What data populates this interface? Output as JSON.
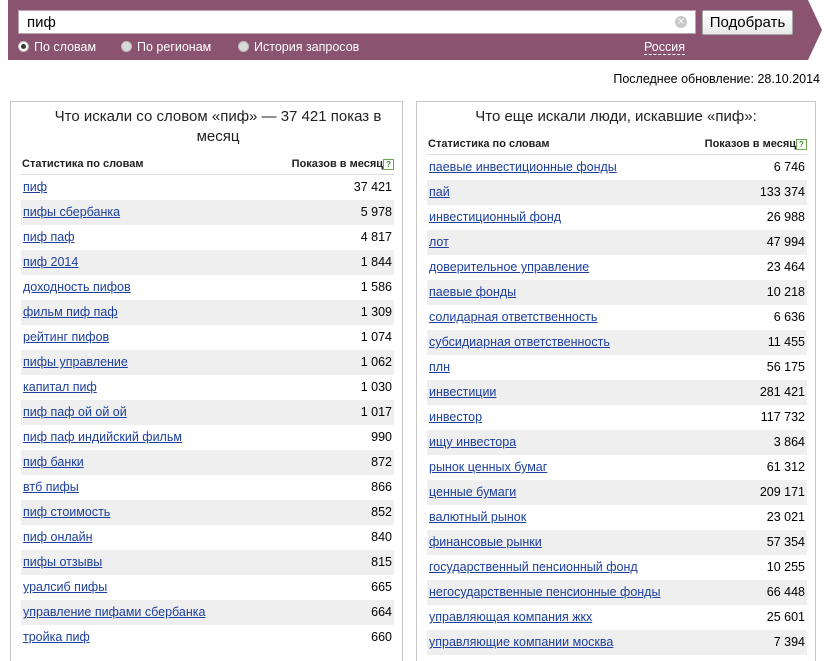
{
  "search": {
    "value": "пиф",
    "submit_label": "Подобрать"
  },
  "modes": [
    {
      "label": "По словам",
      "selected": true
    },
    {
      "label": "По регионам",
      "selected": false
    },
    {
      "label": "История запросов",
      "selected": false
    }
  ],
  "region": "Россия",
  "last_update": "Последнее обновление: 28.10.2014",
  "left": {
    "title": "Что искали со словом «пиф» — 37 421 показ в месяц",
    "col_words": "Статистика по словам",
    "col_count": "Показов в месяц",
    "rows": [
      {
        "q": "пиф",
        "n": "37 421"
      },
      {
        "q": "пифы сбербанка",
        "n": "5 978"
      },
      {
        "q": "пиф паф",
        "n": "4 817"
      },
      {
        "q": "пиф 2014",
        "n": "1 844"
      },
      {
        "q": "доходность пифов",
        "n": "1 586"
      },
      {
        "q": "фильм пиф паф",
        "n": "1 309"
      },
      {
        "q": "рейтинг пифов",
        "n": "1 074"
      },
      {
        "q": "пифы управление",
        "n": "1 062"
      },
      {
        "q": "капитал пиф",
        "n": "1 030"
      },
      {
        "q": "пиф паф ой ой ой",
        "n": "1 017"
      },
      {
        "q": "пиф паф индийский фильм",
        "n": "990"
      },
      {
        "q": "пиф банки",
        "n": "872"
      },
      {
        "q": "втб пифы",
        "n": "866"
      },
      {
        "q": "пиф стоимость",
        "n": "852"
      },
      {
        "q": "пиф онлайн",
        "n": "840"
      },
      {
        "q": "пифы отзывы",
        "n": "815"
      },
      {
        "q": "уралсиб пифы",
        "n": "665"
      },
      {
        "q": "управление пифами сбербанка",
        "n": "664"
      },
      {
        "q": "тройка пиф",
        "n": "660"
      }
    ]
  },
  "right": {
    "title": "Что еще искали люди, искавшие «пиф»:",
    "col_words": "Статистика по словам",
    "col_count": "Показов в месяц",
    "rows": [
      {
        "q": "паевые инвестиционные фонды",
        "n": "6 746"
      },
      {
        "q": "пай",
        "n": "133 374"
      },
      {
        "q": "инвестиционный фонд",
        "n": "26 988"
      },
      {
        "q": "лот",
        "n": "47 994"
      },
      {
        "q": "доверительное управление",
        "n": "23 464"
      },
      {
        "q": "паевые фонды",
        "n": "10 218"
      },
      {
        "q": "солидарная ответственность",
        "n": "6 636"
      },
      {
        "q": "субсидиарная ответственность",
        "n": "11 455"
      },
      {
        "q": "плн",
        "n": "56 175"
      },
      {
        "q": "инвестиции",
        "n": "281 421"
      },
      {
        "q": "инвестор",
        "n": "117 732"
      },
      {
        "q": "ищу инвестора",
        "n": "3 864"
      },
      {
        "q": "рынок ценных бумаг",
        "n": "61 312"
      },
      {
        "q": "ценные бумаги",
        "n": "209 171"
      },
      {
        "q": "валютный рынок",
        "n": "23 021"
      },
      {
        "q": "финансовые рынки",
        "n": "57 354"
      },
      {
        "q": "государственный пенсионный фонд",
        "n": "10 255"
      },
      {
        "q": "негосударственные пенсионные фонды",
        "n": "66 448"
      },
      {
        "q": "управляющая компания жкх",
        "n": "25 601"
      },
      {
        "q": "управляющие компании москва",
        "n": "7 394"
      }
    ]
  },
  "colors": {
    "bar": "#8a5370",
    "link": "#1d3f9e",
    "stripe": "#efefef"
  }
}
